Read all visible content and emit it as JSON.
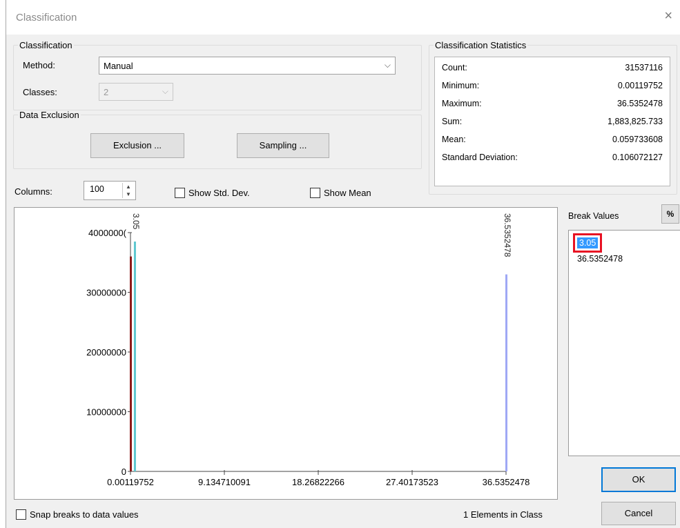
{
  "window": {
    "title": "Classification",
    "close_glyph": "×"
  },
  "classification": {
    "group_label": "Classification",
    "method_label": "Method:",
    "method_value": "Manual",
    "classes_label": "Classes:",
    "classes_value": "2"
  },
  "data_exclusion": {
    "group_label": "Data Exclusion",
    "exclusion_button": "Exclusion ...",
    "sampling_button": "Sampling ..."
  },
  "statistics": {
    "group_label": "Classification Statistics",
    "rows": [
      {
        "label": "Count:",
        "value": "31537116"
      },
      {
        "label": "Minimum:",
        "value": "0.00119752"
      },
      {
        "label": "Maximum:",
        "value": "36.5352478"
      },
      {
        "label": "Sum:",
        "value": "1,883,825.733"
      },
      {
        "label": "Mean:",
        "value": "0.059733608"
      },
      {
        "label": "Standard Deviation:",
        "value": "0.106072127"
      }
    ]
  },
  "histogram_controls": {
    "columns_label": "Columns:",
    "columns_value": "100",
    "show_std_dev_label": "Show Std. Dev.",
    "show_std_dev_checked": false,
    "show_mean_label": "Show Mean",
    "show_mean_checked": false
  },
  "break_values": {
    "header": "Break Values",
    "percent_button": "%",
    "items": [
      "3.05",
      "36.5352478"
    ],
    "selected_index": 0
  },
  "chart_data": {
    "type": "bar",
    "xlim": [
      0.00119752,
      36.5352478
    ],
    "ylim": [
      0,
      40000000
    ],
    "x_ticks": [
      "0.00119752",
      "9.134710091",
      "18.26822266",
      "27.40173523",
      "36.5352478"
    ],
    "y_ticks": [
      "0",
      "10000000",
      "20000000",
      "30000000",
      "4000000("
    ],
    "bars": [
      {
        "x": 0.00119752,
        "value": 36000000,
        "color": "#8b1a1a"
      },
      {
        "x": 0.4,
        "value": 38500000,
        "color": "#5cc7cf"
      },
      {
        "x": 36.5352478,
        "value": 33000000,
        "color": "#9fa8f5"
      }
    ],
    "break_lines": [
      {
        "x": 0.4,
        "label": "3.05"
      },
      {
        "x": 36.5352478,
        "label": "36.5352478"
      }
    ],
    "line_color": "#444444"
  },
  "footer": {
    "snap_label": "Snap breaks to data values",
    "snap_checked": false,
    "elements_text": "1 Elements in Class",
    "ok_button": "OK",
    "cancel_button": "Cancel"
  }
}
